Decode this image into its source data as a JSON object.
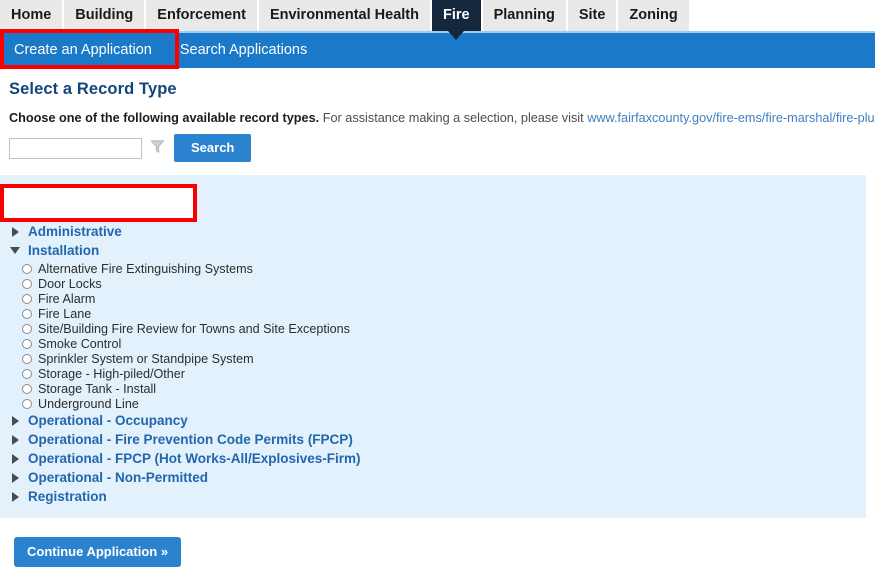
{
  "module_tabs": [
    {
      "label": "Home",
      "active": false
    },
    {
      "label": "Building",
      "active": false
    },
    {
      "label": "Enforcement",
      "active": false
    },
    {
      "label": "Environmental Health",
      "active": false
    },
    {
      "label": "Fire",
      "active": true
    },
    {
      "label": "Planning",
      "active": false
    },
    {
      "label": "Site",
      "active": false
    },
    {
      "label": "Zoning",
      "active": false
    }
  ],
  "sub_nav": {
    "tabs": [
      {
        "label": "Create an Application",
        "active": true
      },
      {
        "label": "Search Applications",
        "active": false
      }
    ]
  },
  "page": {
    "title": "Select a Record Type",
    "instruction_strong": "Choose one of the following available record types.",
    "instruction_rest": "For assistance making a selection, please visit",
    "link_text": "www.fairfaxcounty.gov/fire-ems/fire-marshal/fire-plus."
  },
  "search": {
    "value": "",
    "placeholder": "",
    "filter_icon": "funnel-filter-icon",
    "button_label": "Search"
  },
  "record_types": [
    {
      "label": "Administrative",
      "expanded": false,
      "items": []
    },
    {
      "label": "Installation",
      "expanded": true,
      "items": [
        {
          "label": "Alternative Fire Extinguishing Systems",
          "selected": false,
          "highlighted": false
        },
        {
          "label": "Door Locks",
          "selected": false,
          "highlighted": false
        },
        {
          "label": "Fire Alarm",
          "selected": false,
          "highlighted": false
        },
        {
          "label": "Fire Lane",
          "selected": false,
          "highlighted": false
        },
        {
          "label": "Site/Building Fire Review for Towns and Site Exceptions",
          "selected": false,
          "highlighted": false
        },
        {
          "label": "Smoke Control",
          "selected": false,
          "highlighted": false
        },
        {
          "label": "Sprinkler System or Standpipe System",
          "selected": false,
          "highlighted": false
        },
        {
          "label": "Storage - High-piled/Other",
          "selected": false,
          "highlighted": true
        },
        {
          "label": "Storage Tank - Install",
          "selected": false,
          "highlighted": false
        },
        {
          "label": "Underground Line",
          "selected": false,
          "highlighted": false
        }
      ]
    },
    {
      "label": "Operational - Occupancy",
      "expanded": false,
      "items": []
    },
    {
      "label": "Operational - Fire Prevention Code Permits (FPCP)",
      "expanded": false,
      "items": []
    },
    {
      "label": "Operational - FPCP (Hot Works-All/Explosives-Firm)",
      "expanded": false,
      "items": []
    },
    {
      "label": "Operational - Non-Permitted",
      "expanded": false,
      "items": []
    },
    {
      "label": "Registration",
      "expanded": false,
      "items": []
    }
  ],
  "footer": {
    "continue_label": "Continue Application »"
  },
  "colors": {
    "accent_blue": "#2b83cf",
    "nav_blue": "#1a7ac9",
    "active_tab_navy": "#14273d",
    "panel_bg": "#e2f1fb",
    "group_link": "#2167ae",
    "title_navy": "#13457e",
    "annotation_red": "#fc0000"
  }
}
